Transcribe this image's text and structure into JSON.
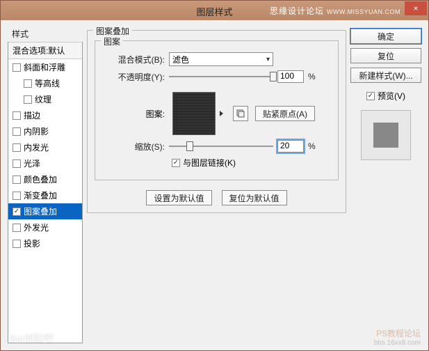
{
  "titlebar": {
    "title": "图层样式",
    "watermark_cn": "思缘设计论坛",
    "watermark_en": "WWW.MISSYUAN.COM",
    "close": "×"
  },
  "left": {
    "header": "样式",
    "subheader": "混合选项:默认",
    "items": [
      {
        "label": "斜面和浮雕",
        "checked": false,
        "indent": false
      },
      {
        "label": "等高线",
        "checked": false,
        "indent": true
      },
      {
        "label": "纹理",
        "checked": false,
        "indent": true
      },
      {
        "label": "描边",
        "checked": false,
        "indent": false
      },
      {
        "label": "内阴影",
        "checked": false,
        "indent": false
      },
      {
        "label": "内发光",
        "checked": false,
        "indent": false
      },
      {
        "label": "光泽",
        "checked": false,
        "indent": false
      },
      {
        "label": "颜色叠加",
        "checked": false,
        "indent": false
      },
      {
        "label": "渐变叠加",
        "checked": false,
        "indent": false
      },
      {
        "label": "图案叠加",
        "checked": true,
        "indent": false,
        "selected": true
      },
      {
        "label": "外发光",
        "checked": false,
        "indent": false
      },
      {
        "label": "投影",
        "checked": false,
        "indent": false
      }
    ]
  },
  "middle": {
    "fieldset_title": "图案叠加",
    "inner_title": "图案",
    "blend_label": "混合模式(B):",
    "blend_value": "滤色",
    "opacity_label": "不透明度(Y):",
    "opacity_value": "100",
    "opacity_pct": 100,
    "pct": "%",
    "pattern_label": "图案:",
    "snap_label": "贴紧原点(A)",
    "scale_label": "缩放(S):",
    "scale_value": "20",
    "scale_pct": 20,
    "link_label": "与图层链接(K)",
    "link_checked": true,
    "set_default": "设置为默认值",
    "reset_default": "复位为默认值"
  },
  "right": {
    "ok": "确定",
    "cancel": "复位",
    "new_style": "新建样式(W)...",
    "preview_label": "预览(V)",
    "preview_checked": true
  },
  "footer": {
    "bl": "Bai创贴吧",
    "br1": "PS教程论坛",
    "br2": "bbs.16xx8.com"
  }
}
